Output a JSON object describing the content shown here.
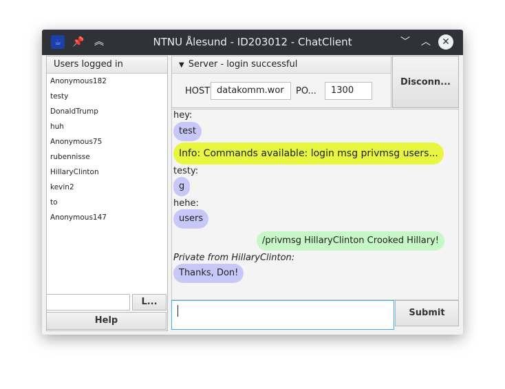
{
  "window": {
    "title": "NTNU Ålesund - ID203012 - ChatClient",
    "icons": [
      "app-icon",
      "pin-icon",
      "keep-above-icon",
      "minimize-icon",
      "maximize-icon",
      "close-icon"
    ]
  },
  "users": {
    "header": "Users logged in",
    "list": [
      "Anonymous182",
      "testy",
      "DonaldTrump",
      "huh",
      "Anonymous75",
      "rubennisse",
      "HillaryClinton",
      "kevin2",
      "to",
      "Anonymous147"
    ],
    "l_button": "L...",
    "help_button": "Help"
  },
  "server": {
    "header": "Server - login successful",
    "host_label": "HOST",
    "host_value": "datakomm.wor",
    "port_label": "PO...",
    "port_value": "1300",
    "disconnect_button": "Disconn..."
  },
  "chat": {
    "messages": [
      {
        "sender": "hey:",
        "text": "test",
        "style": "purple"
      },
      {
        "sender": "",
        "text": "Info: Commands available: login msg privmsg users...",
        "style": "yellow"
      },
      {
        "sender": "testy:",
        "text": "g",
        "style": "purple"
      },
      {
        "sender": "hehe:",
        "text": "users",
        "style": "purple"
      },
      {
        "sender": "",
        "text": "/privmsg HillaryClinton Crooked Hillary!",
        "style": "green"
      },
      {
        "sender": "Private from HillaryClinton:",
        "text": "Thanks, Don!",
        "style": "purple"
      }
    ],
    "submit_button": "Submit"
  },
  "colors": {
    "titlebar": "#2f3338",
    "bubble_purple": "#c8c8f8",
    "bubble_yellow": "#e9f63f",
    "bubble_green": "#c6f7c6",
    "focus": "#3daee9"
  }
}
